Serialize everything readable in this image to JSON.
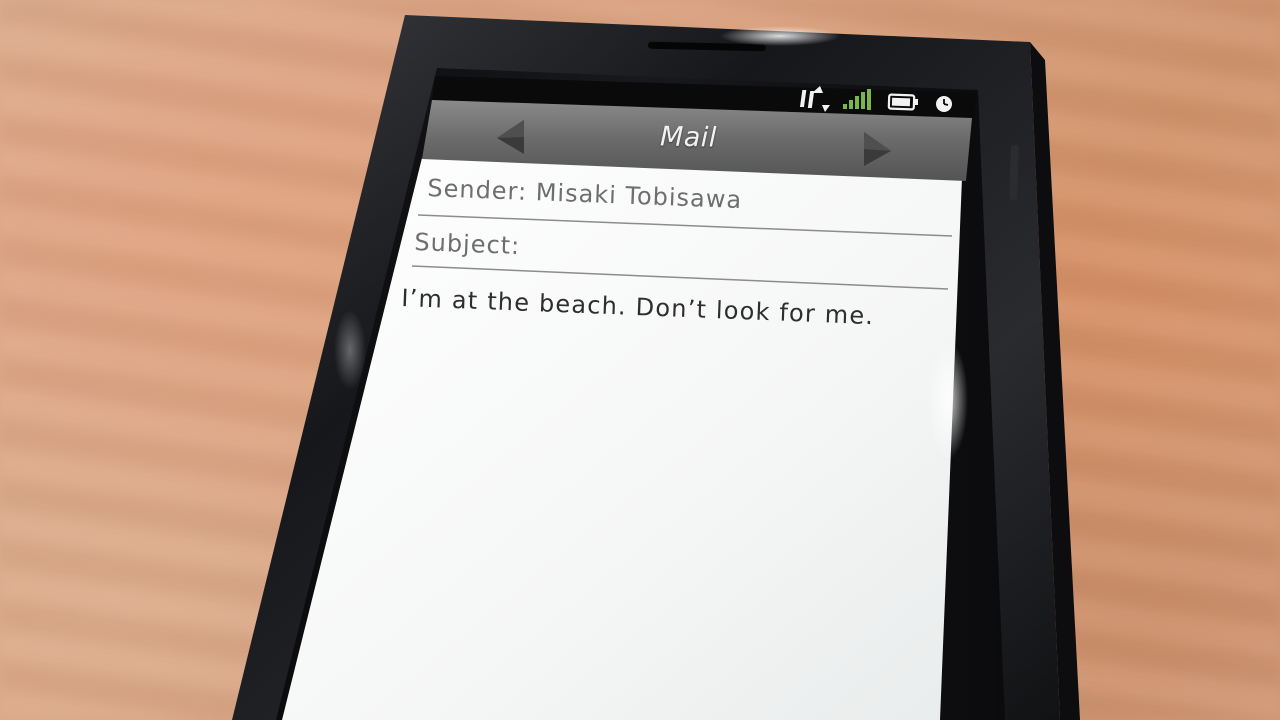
{
  "header": {
    "title": "Mail",
    "prev_icon": "triangle-left-icon",
    "next_icon": "triangle-right-icon"
  },
  "status_bar": {
    "icons": [
      "data-transfer-icon",
      "signal-bars-icon",
      "battery-icon",
      "clock-icon"
    ],
    "signal_color": "#7ab648"
  },
  "message": {
    "sender_label": "Sender:",
    "sender_name": "Misaki Tobisawa",
    "subject_label": "Subject:",
    "subject_value": "",
    "body": "I’m at the beach. Don’t look for me."
  },
  "colors": {
    "header_bar": "#6b6b6b",
    "screen_bg": "#f7f8f8",
    "phone_frame": "#1c1d20"
  }
}
